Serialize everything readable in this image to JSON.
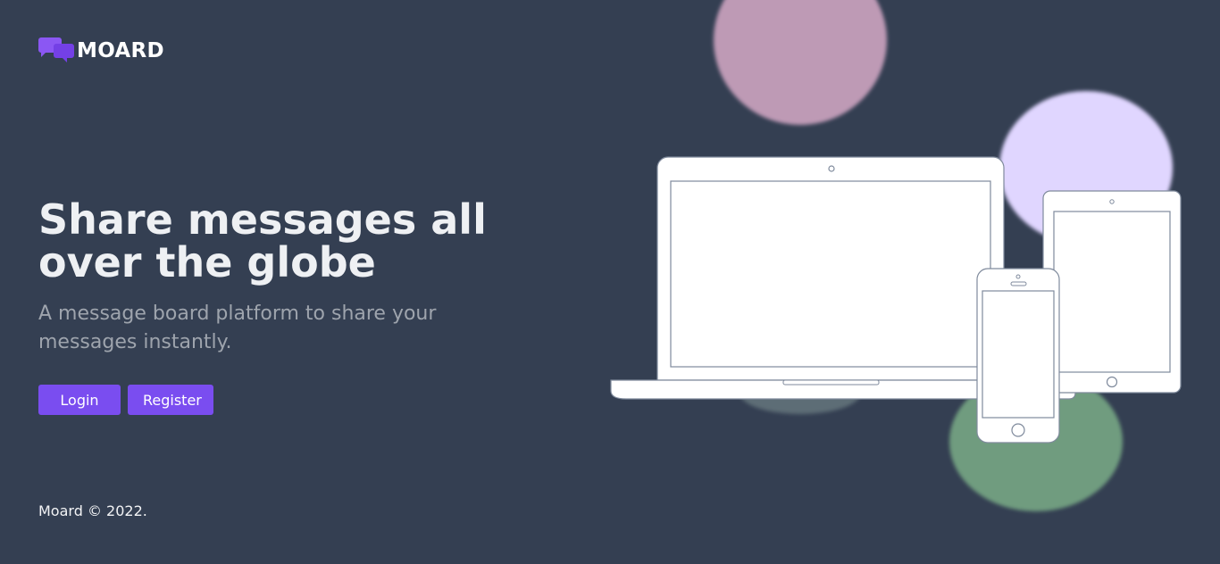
{
  "brand": {
    "name": "MOARD",
    "logo_icon": "chat-bubbles-icon",
    "color": "#8b57f3"
  },
  "hero": {
    "title": "Share messages all over the globe",
    "subtitle": "A message board platform to share your messages instantly."
  },
  "actions": {
    "login_label": "Login",
    "register_label": "Register"
  },
  "footer": {
    "copyright": "Moard © 2022."
  },
  "illustration": {
    "devices": [
      "laptop-icon",
      "tablet-icon",
      "phone-icon"
    ],
    "blob_colors": [
      "#be9ab5",
      "#e0d6ff",
      "#6f9c7f",
      "#5d6d76"
    ]
  },
  "colors": {
    "background": "#343f52",
    "accent": "#7a4df0",
    "text_light": "#eef0f3",
    "text_muted": "#9ea4ad"
  }
}
